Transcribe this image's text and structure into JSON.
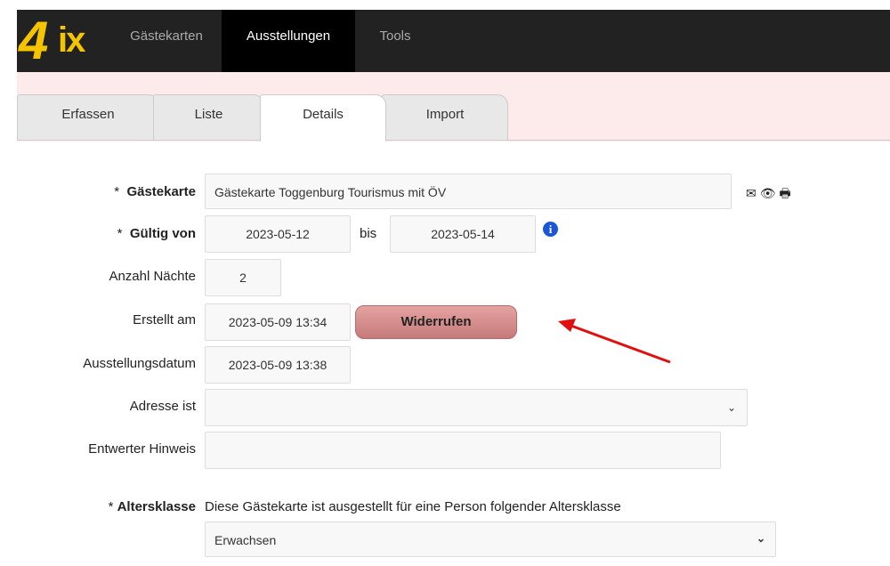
{
  "app": {
    "logo": {
      "four": "4",
      "ix": "ix"
    },
    "nav": [
      "Gästekarten",
      "Ausstellungen",
      "Tools"
    ],
    "active_nav": "Ausstellungen"
  },
  "tabs": [
    "Erfassen",
    "Liste",
    "Details",
    "Import"
  ],
  "active_tab": "Details",
  "form": {
    "gaestekarte": {
      "label_star": "*",
      "label": "Gästekarte",
      "value": "Gästekarte Toggenburg Tourismus mit ÖV"
    },
    "gueltig_von": {
      "label_star": "*",
      "label": "Gültig von",
      "value": "2023-05-12",
      "bis_label": "bis",
      "bis_value": "2023-05-14"
    },
    "anzahl_naechte": {
      "label": "Anzahl Nächte",
      "value": "2"
    },
    "erstellt_am": {
      "label": "Erstellt am",
      "value": "2023-05-09 13:34",
      "button": "Widerrufen"
    },
    "ausstellungsdatum": {
      "label": "Ausstellungsdatum",
      "value": "2023-05-09 13:38"
    },
    "adresse_ist": {
      "label": "Adresse ist",
      "value": ""
    },
    "entwerter_hinweis": {
      "label": "Entwerter Hinweis",
      "value": ""
    },
    "altersklasse": {
      "label_star": "*",
      "label": "Altersklasse",
      "description": "Diese Gästekarte ist ausgestellt für eine Person folgender Altersklasse",
      "value": "Erwachsen"
    }
  },
  "icons": [
    "envelope-icon",
    "eye-icon",
    "printer-icon",
    "info-icon",
    "chevron-down-icon"
  ],
  "colors": {
    "topbar": "#222222",
    "logo": "#f5c400",
    "pinkband": "#fdeaea",
    "button": "#d48e8e",
    "arrow": "#e01010",
    "info": "#1a56d6"
  }
}
